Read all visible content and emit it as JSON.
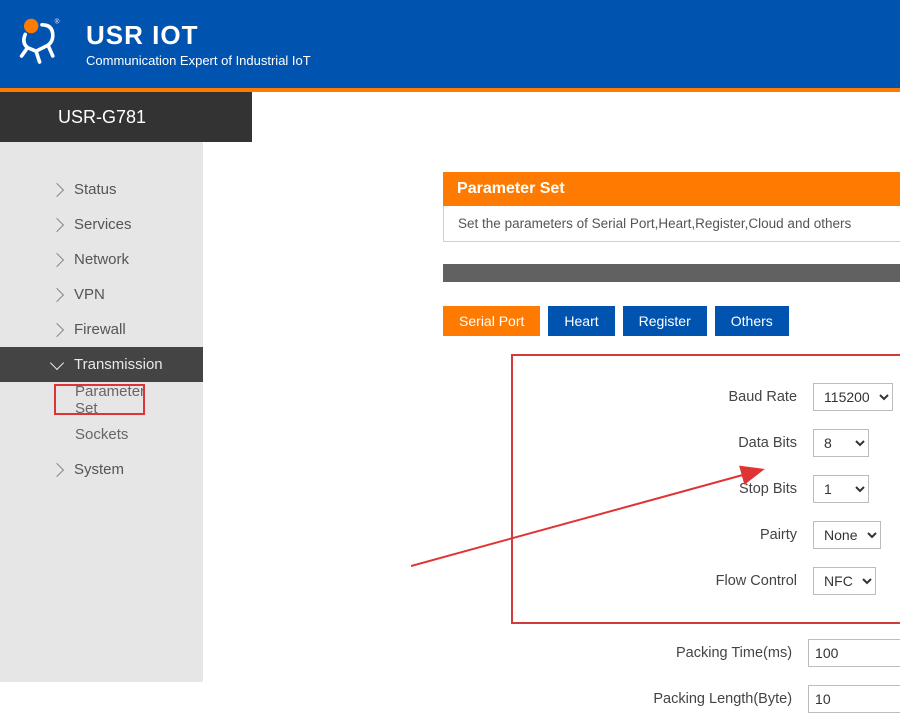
{
  "header": {
    "brand": "USR IOT",
    "tagline": "Communication Expert of Industrial IoT"
  },
  "device_name": "USR-G781",
  "sidebar": {
    "items": [
      {
        "label": "Status",
        "expanded": false
      },
      {
        "label": "Services",
        "expanded": false
      },
      {
        "label": "Network",
        "expanded": false
      },
      {
        "label": "VPN",
        "expanded": false
      },
      {
        "label": "Firewall",
        "expanded": false
      },
      {
        "label": "Transmission",
        "expanded": true,
        "children": [
          {
            "label": "Parameter Set",
            "highlight": true
          },
          {
            "label": "Sockets",
            "highlight": false
          }
        ]
      },
      {
        "label": "System",
        "expanded": false
      }
    ]
  },
  "panel": {
    "title": "Parameter Set",
    "description": "Set the parameters of Serial Port,Heart,Register,Cloud and others"
  },
  "tabs": [
    {
      "label": "Serial Port",
      "active": true
    },
    {
      "label": "Heart",
      "active": false
    },
    {
      "label": "Register",
      "active": false
    },
    {
      "label": "Others",
      "active": false
    }
  ],
  "form": {
    "boxed": [
      {
        "label": "Baud Rate",
        "value": "115200",
        "type": "select"
      },
      {
        "label": "Data Bits",
        "value": "8",
        "type": "select"
      },
      {
        "label": "Stop Bits",
        "value": "1",
        "type": "select"
      },
      {
        "label": "Pairty",
        "value": "None",
        "type": "select"
      },
      {
        "label": "Flow Control",
        "value": "NFC",
        "type": "select"
      }
    ],
    "rest": [
      {
        "label": "Packing Time(ms)",
        "value": "100",
        "type": "text"
      },
      {
        "label": "Packing Length(Byte)",
        "value": "10",
        "type": "text"
      }
    ]
  }
}
